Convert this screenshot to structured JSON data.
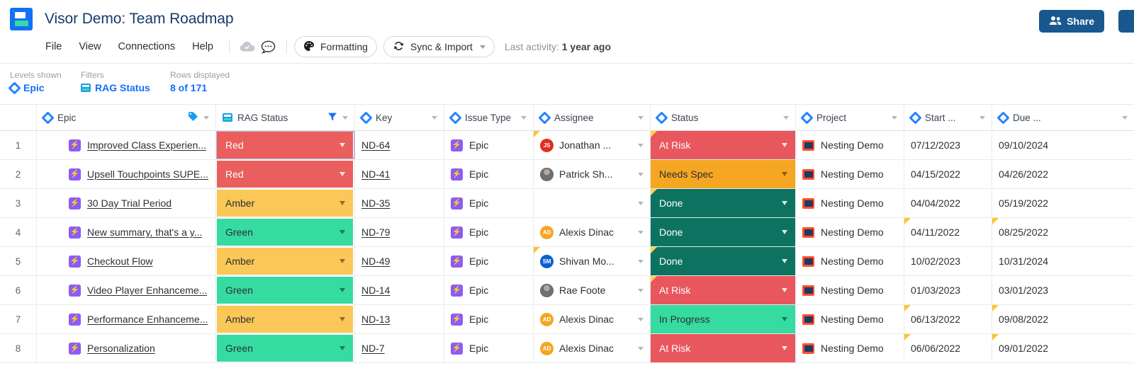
{
  "app": {
    "title": "Visor Demo: Team Roadmap",
    "logo_name": "visor-logo"
  },
  "menu": {
    "items": [
      "File",
      "View",
      "Connections",
      "Help"
    ],
    "cloud_icon": "cloud-check-icon",
    "comment_icon": "comment-icon",
    "formatting_label": "Formatting",
    "formatting_icon": "palette-icon",
    "sync_label": "Sync & Import",
    "sync_icon": "sync-icon",
    "last_activity_label": "Last activity:",
    "last_activity_value": "1 year ago"
  },
  "header_actions": {
    "share_label": "Share",
    "share_icon": "people-icon",
    "share_color": "#18588f"
  },
  "subbar": {
    "levels_label": "Levels shown",
    "levels_value": "Epic",
    "filters_label": "Filters",
    "filters_value": "RAG Status",
    "rows_label": "Rows displayed",
    "rows_value": "8 of 171"
  },
  "columns": [
    {
      "label": "Epic",
      "icon": "jira-diamond-icon",
      "extra_icon": "tag-icon"
    },
    {
      "label": "RAG Status",
      "icon": "card-icon",
      "extra_icon": "filter-icon"
    },
    {
      "label": "Key",
      "icon": "jira-diamond-icon",
      "extra_icon": ""
    },
    {
      "label": "Issue Type",
      "icon": "jira-diamond-icon",
      "extra_icon": ""
    },
    {
      "label": "Assignee",
      "icon": "jira-diamond-icon",
      "extra_icon": ""
    },
    {
      "label": "Status",
      "icon": "jira-diamond-icon",
      "extra_icon": ""
    },
    {
      "label": "Project",
      "icon": "jira-diamond-icon",
      "extra_icon": ""
    },
    {
      "label": "Start ...",
      "icon": "jira-diamond-icon",
      "extra_icon": ""
    },
    {
      "label": "Due ...",
      "icon": "jira-diamond-icon",
      "extra_icon": ""
    }
  ],
  "colors": {
    "rag_red": "#ea5e5e",
    "rag_amber": "#fbc756",
    "rag_green": "#36dba1",
    "status_at_risk": "#e8565e",
    "status_needs_spec": "#f5a623",
    "status_done": "#0d7360",
    "status_in_progress": "#36dba1",
    "link_blue": "#1271f5",
    "title_blue": "#173a6a"
  },
  "rows": [
    {
      "num": "1",
      "epic": "Improved Class Experien...",
      "rag": "Red",
      "rag_color": "#ea5e5e",
      "rag_light": true,
      "key": "ND-64",
      "type": "Epic",
      "assignee": "Jonathan ...",
      "avatar_initials": "JS",
      "avatar_color": "#e0301e",
      "avatar_photo": false,
      "status": "At Risk",
      "status_color": "#e8565e",
      "status_light": true,
      "project": "Nesting Demo",
      "start": "07/12/2023",
      "due": "09/10/2024",
      "flag_assignee": true,
      "flag_status": true,
      "flag_start": false,
      "flag_due": false
    },
    {
      "num": "2",
      "epic": "Upsell Touchpoints SUPE...",
      "rag": "Red",
      "rag_color": "#ea5e5e",
      "rag_light": true,
      "key": "ND-41",
      "type": "Epic",
      "assignee": "Patrick Sh...",
      "avatar_initials": "",
      "avatar_color": "#6d6f74",
      "avatar_photo": true,
      "status": "Needs Spec",
      "status_color": "#f5a623",
      "status_light": false,
      "project": "Nesting Demo",
      "start": "04/15/2022",
      "due": "04/26/2022",
      "flag_assignee": false,
      "flag_status": false,
      "flag_start": false,
      "flag_due": false
    },
    {
      "num": "3",
      "epic": "30 Day Trial Period",
      "rag": "Amber",
      "rag_color": "#fbc756",
      "rag_light": false,
      "key": "ND-35",
      "type": "Epic",
      "assignee": "",
      "avatar_initials": "",
      "avatar_color": "",
      "avatar_photo": false,
      "status": "Done",
      "status_color": "#0d7360",
      "status_light": true,
      "project": "Nesting Demo",
      "start": "04/04/2022",
      "due": "05/19/2022",
      "flag_assignee": false,
      "flag_status": true,
      "flag_start": false,
      "flag_due": false
    },
    {
      "num": "4",
      "epic": "New summary, that's a y...",
      "rag": "Green",
      "rag_color": "#36dba1",
      "rag_light": false,
      "key": "ND-79",
      "type": "Epic",
      "assignee": "Alexis Dinac",
      "avatar_initials": "AD",
      "avatar_color": "#f5a623",
      "avatar_photo": false,
      "status": "Done",
      "status_color": "#0d7360",
      "status_light": true,
      "project": "Nesting Demo",
      "start": "04/11/2022",
      "due": "08/25/2022",
      "flag_assignee": false,
      "flag_status": false,
      "flag_start": true,
      "flag_due": true
    },
    {
      "num": "5",
      "epic": "Checkout Flow",
      "rag": "Amber",
      "rag_color": "#fbc756",
      "rag_light": false,
      "key": "ND-49",
      "type": "Epic",
      "assignee": "Shivan Mo...",
      "avatar_initials": "SM",
      "avatar_color": "#0b5fd0",
      "avatar_photo": false,
      "status": "Done",
      "status_color": "#0d7360",
      "status_light": true,
      "project": "Nesting Demo",
      "start": "10/02/2023",
      "due": "10/31/2024",
      "flag_assignee": true,
      "flag_status": true,
      "flag_start": false,
      "flag_due": false
    },
    {
      "num": "6",
      "epic": "Video Player Enhanceme...",
      "rag": "Green",
      "rag_color": "#36dba1",
      "rag_light": false,
      "key": "ND-14",
      "type": "Epic",
      "assignee": "Rae Foote",
      "avatar_initials": "",
      "avatar_color": "#6d6f74",
      "avatar_photo": true,
      "status": "At Risk",
      "status_color": "#e8565e",
      "status_light": true,
      "project": "Nesting Demo",
      "start": "01/03/2023",
      "due": "03/01/2023",
      "flag_assignee": false,
      "flag_status": true,
      "flag_start": false,
      "flag_due": false
    },
    {
      "num": "7",
      "epic": "Performance Enhanceme...",
      "rag": "Amber",
      "rag_color": "#fbc756",
      "rag_light": false,
      "key": "ND-13",
      "type": "Epic",
      "assignee": "Alexis Dinac",
      "avatar_initials": "AD",
      "avatar_color": "#f5a623",
      "avatar_photo": false,
      "status": "In Progress",
      "status_color": "#36dba1",
      "status_light": false,
      "project": "Nesting Demo",
      "start": "06/13/2022",
      "due": "09/08/2022",
      "flag_assignee": false,
      "flag_status": false,
      "flag_start": true,
      "flag_due": true
    },
    {
      "num": "8",
      "epic": "Personalization",
      "rag": "Green",
      "rag_color": "#36dba1",
      "rag_light": false,
      "key": "ND-7",
      "type": "Epic",
      "assignee": "Alexis Dinac",
      "avatar_initials": "AD",
      "avatar_color": "#f5a623",
      "avatar_photo": false,
      "status": "At Risk",
      "status_color": "#e8565e",
      "status_light": true,
      "project": "Nesting Demo",
      "start": "06/06/2022",
      "due": "09/01/2022",
      "flag_assignee": false,
      "flag_status": false,
      "flag_start": true,
      "flag_due": true
    }
  ]
}
